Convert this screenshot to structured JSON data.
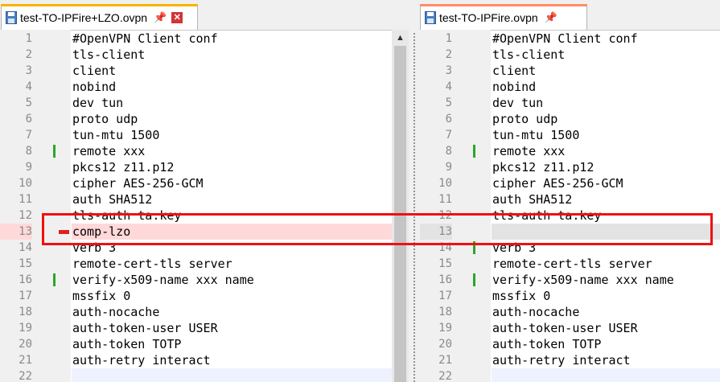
{
  "colors": {
    "added_mark": "#2ca52c",
    "removed_mark": "#e02020",
    "removed_bg": "#ffd9d9",
    "blank_bg": "#e3e3e3",
    "annotation": "#ee1111",
    "left_tab_accent": "#f7b500",
    "right_tab_accent": "#ff8c66"
  },
  "left": {
    "tab_title": "test-TO-IPFire+LZO.ovpn",
    "pin_icon": "pin-icon",
    "close_icon": "close-icon",
    "lines": [
      {
        "n": "1",
        "text": "#OpenVPN Client conf",
        "state": "normal",
        "mark": ""
      },
      {
        "n": "2",
        "text": "tls-client",
        "state": "normal",
        "mark": ""
      },
      {
        "n": "3",
        "text": "client",
        "state": "normal",
        "mark": ""
      },
      {
        "n": "4",
        "text": "nobind",
        "state": "normal",
        "mark": ""
      },
      {
        "n": "5",
        "text": "dev tun",
        "state": "normal",
        "mark": ""
      },
      {
        "n": "6",
        "text": "proto udp",
        "state": "normal",
        "mark": ""
      },
      {
        "n": "7",
        "text": "tun-mtu 1500",
        "state": "normal",
        "mark": ""
      },
      {
        "n": "8",
        "text": "remote xxx",
        "state": "normal",
        "mark": "changed"
      },
      {
        "n": "9",
        "text": "pkcs12 z11.p12",
        "state": "normal",
        "mark": ""
      },
      {
        "n": "10",
        "text": "cipher AES-256-GCM",
        "state": "normal",
        "mark": ""
      },
      {
        "n": "11",
        "text": "auth SHA512",
        "state": "normal",
        "mark": ""
      },
      {
        "n": "12",
        "text": "tls-auth ta.key",
        "state": "normal",
        "mark": ""
      },
      {
        "n": "13",
        "text": "comp-lzo",
        "state": "removed",
        "mark": "deleted"
      },
      {
        "n": "14",
        "text": "verb 3",
        "state": "normal",
        "mark": ""
      },
      {
        "n": "15",
        "text": "remote-cert-tls server",
        "state": "normal",
        "mark": ""
      },
      {
        "n": "16",
        "text": "verify-x509-name xxx name",
        "state": "normal",
        "mark": "changed"
      },
      {
        "n": "17",
        "text": "mssfix 0",
        "state": "normal",
        "mark": ""
      },
      {
        "n": "18",
        "text": "auth-nocache",
        "state": "normal",
        "mark": ""
      },
      {
        "n": "19",
        "text": "auth-token-user USER",
        "state": "normal",
        "mark": ""
      },
      {
        "n": "20",
        "text": "auth-token TOTP",
        "state": "normal",
        "mark": ""
      },
      {
        "n": "21",
        "text": "auth-retry interact",
        "state": "normal",
        "mark": ""
      },
      {
        "n": "22",
        "text": "",
        "state": "current",
        "mark": ""
      }
    ]
  },
  "right": {
    "tab_title": "test-TO-IPFire.ovpn",
    "pin_icon": "pin-icon",
    "close_icon": "close-icon",
    "lines": [
      {
        "n": "1",
        "text": "#OpenVPN Client conf",
        "state": "normal",
        "mark": ""
      },
      {
        "n": "2",
        "text": "tls-client",
        "state": "normal",
        "mark": ""
      },
      {
        "n": "3",
        "text": "client",
        "state": "normal",
        "mark": ""
      },
      {
        "n": "4",
        "text": "nobind",
        "state": "normal",
        "mark": ""
      },
      {
        "n": "5",
        "text": "dev tun",
        "state": "normal",
        "mark": ""
      },
      {
        "n": "6",
        "text": "proto udp",
        "state": "normal",
        "mark": ""
      },
      {
        "n": "7",
        "text": "tun-mtu 1500",
        "state": "normal",
        "mark": ""
      },
      {
        "n": "8",
        "text": "remote xxx",
        "state": "normal",
        "mark": "changed"
      },
      {
        "n": "9",
        "text": "pkcs12 z11.p12",
        "state": "normal",
        "mark": ""
      },
      {
        "n": "10",
        "text": "cipher AES-256-GCM",
        "state": "normal",
        "mark": ""
      },
      {
        "n": "11",
        "text": "auth SHA512",
        "state": "normal",
        "mark": ""
      },
      {
        "n": "12",
        "text": "tls-auth ta.key",
        "state": "normal",
        "mark": ""
      },
      {
        "n": "13",
        "text": "",
        "state": "blank",
        "mark": ""
      },
      {
        "n": "14",
        "text": "verb 3",
        "state": "normal",
        "mark": "changed"
      },
      {
        "n": "15",
        "text": "remote-cert-tls server",
        "state": "normal",
        "mark": ""
      },
      {
        "n": "16",
        "text": "verify-x509-name xxx name",
        "state": "normal",
        "mark": "changed"
      },
      {
        "n": "17",
        "text": "mssfix 0",
        "state": "normal",
        "mark": ""
      },
      {
        "n": "18",
        "text": "auth-nocache",
        "state": "normal",
        "mark": ""
      },
      {
        "n": "19",
        "text": "auth-token-user USER",
        "state": "normal",
        "mark": ""
      },
      {
        "n": "20",
        "text": "auth-token TOTP",
        "state": "normal",
        "mark": ""
      },
      {
        "n": "21",
        "text": "auth-retry interact",
        "state": "normal",
        "mark": ""
      },
      {
        "n": "22",
        "text": "",
        "state": "current",
        "mark": ""
      }
    ]
  }
}
